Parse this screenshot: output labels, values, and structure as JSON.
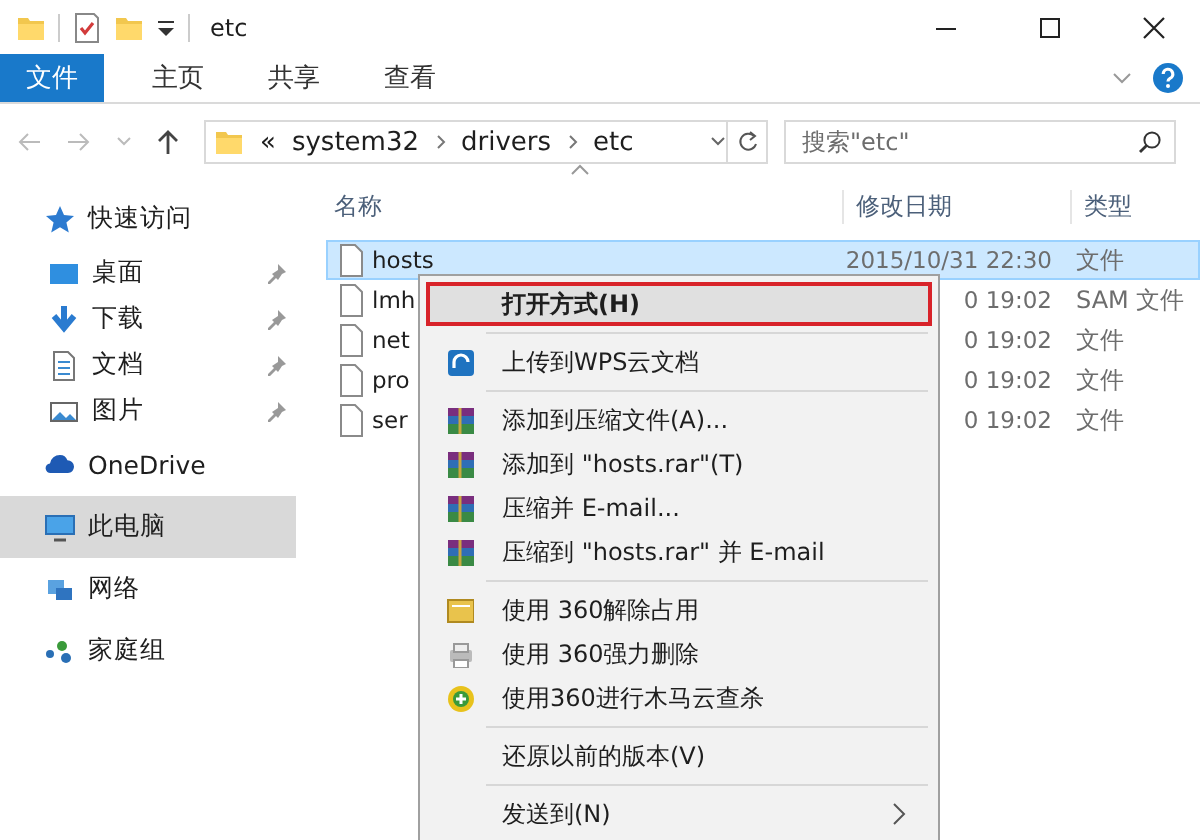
{
  "window": {
    "title": "etc"
  },
  "ribbon": {
    "tabs": [
      {
        "label": "文件",
        "kind": "file"
      },
      {
        "label": "主页",
        "kind": "tab"
      },
      {
        "label": "共享",
        "kind": "tab"
      },
      {
        "label": "查看",
        "kind": "tab"
      }
    ]
  },
  "address": {
    "prefix": "«",
    "path": [
      "system32",
      "drivers",
      "etc"
    ],
    "search_placeholder": "搜索\"etc\""
  },
  "sidebar": {
    "items": [
      {
        "label": "快速访问",
        "selected": false,
        "children": [
          {
            "label": "桌面",
            "pinned": true,
            "selected": false
          },
          {
            "label": "下载",
            "pinned": true,
            "selected": false
          },
          {
            "label": "文档",
            "pinned": true,
            "selected": false
          },
          {
            "label": "图片",
            "pinned": true,
            "selected": false
          }
        ]
      },
      {
        "label": "OneDrive",
        "selected": false
      },
      {
        "label": "此电脑",
        "selected": true
      },
      {
        "label": "网络",
        "selected": false
      },
      {
        "label": "家庭组",
        "selected": false
      }
    ]
  },
  "table": {
    "columns": [
      "名称",
      "修改日期",
      "类型"
    ],
    "rows": [
      {
        "name": "hosts",
        "date": "2015/10/31 22:30",
        "type": "文件",
        "selected": true
      },
      {
        "name": "lmh",
        "date": "0 19:02",
        "type": "SAM 文件",
        "selected": false
      },
      {
        "name": "net",
        "date": "0 19:02",
        "type": "文件",
        "selected": false
      },
      {
        "name": "pro",
        "date": "0 19:02",
        "type": "文件",
        "selected": false
      },
      {
        "name": "ser",
        "date": "0 19:02",
        "type": "文件",
        "selected": false
      }
    ]
  },
  "context_menu": {
    "groups": [
      [
        {
          "label": "打开方式(H)",
          "selected": true,
          "submenu": false
        }
      ],
      [
        {
          "label": "上传到WPS云文档",
          "selected": false,
          "submenu": false
        }
      ],
      [
        {
          "label": "添加到压缩文件(A)...",
          "selected": false,
          "submenu": false
        },
        {
          "label": "添加到 \"hosts.rar\"(T)",
          "selected": false,
          "submenu": false
        },
        {
          "label": "压缩并 E-mail...",
          "selected": false,
          "submenu": false
        },
        {
          "label": "压缩到 \"hosts.rar\" 并 E-mail",
          "selected": false,
          "submenu": false
        }
      ],
      [
        {
          "label": "使用 360解除占用",
          "selected": false,
          "submenu": false
        },
        {
          "label": "使用 360强力删除",
          "selected": false,
          "submenu": false
        },
        {
          "label": "使用360进行木马云查杀",
          "selected": false,
          "submenu": false
        }
      ],
      [
        {
          "label": "还原以前的版本(V)",
          "selected": false,
          "submenu": false
        }
      ],
      [
        {
          "label": "发送到(N)",
          "selected": false,
          "submenu": true
        }
      ]
    ]
  }
}
